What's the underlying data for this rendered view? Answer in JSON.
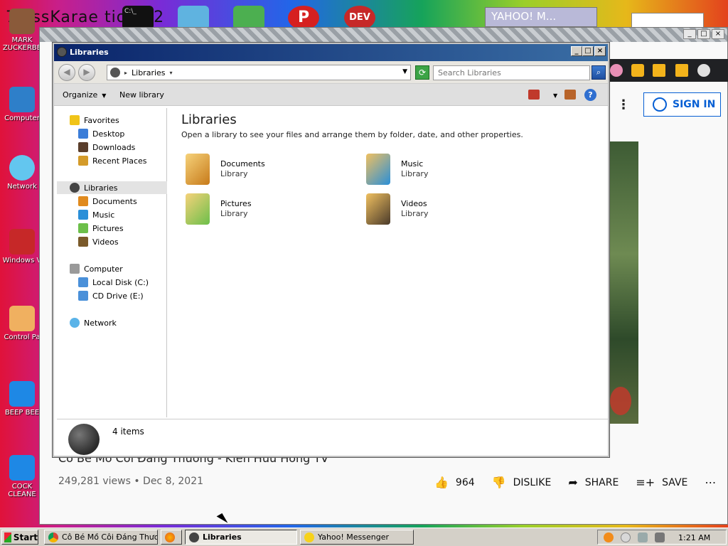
{
  "desktop": {
    "top_text": "7 ossKarae tio 012",
    "icons": [
      {
        "label": "MARK ZUCKERBE"
      },
      {
        "label": "Computer"
      },
      {
        "label": "Network"
      },
      {
        "label": "Windows V"
      },
      {
        "label": "Control Pa"
      },
      {
        "label": "BEEP BEE"
      },
      {
        "label": "COCK CLEANE"
      }
    ],
    "top_icons": [
      {
        "name": "terminal-icon",
        "label": "C:\\_"
      },
      {
        "name": "folder-icon",
        "label": ""
      },
      {
        "name": "game-icon",
        "label": ""
      },
      {
        "name": "p-icon",
        "label": "P"
      },
      {
        "name": "dev-icon",
        "label": "DEV"
      }
    ],
    "yahoo_title": "YAHOO! M..."
  },
  "browser": {
    "signin": "SIGN IN",
    "video_title": "Cô Bé Mồ Côi Đáng Thương - Kiến Hữu Hồng TV",
    "views": "249,281 views • Dec 8, 2021",
    "likes": "964",
    "dislike": "DISLIKE",
    "share": "SHARE",
    "save": "SAVE"
  },
  "explorer": {
    "title": "Libraries",
    "address": "Libraries",
    "search_placeholder": "Search Libraries",
    "organize": "Organize",
    "new_library": "New library",
    "nav": {
      "favorites": "Favorites",
      "desktop": "Desktop",
      "downloads": "Downloads",
      "recent": "Recent Places",
      "libraries": "Libraries",
      "documents": "Documents",
      "music": "Music",
      "pictures": "Pictures",
      "videos": "Videos",
      "computer": "Computer",
      "local_disk": "Local Disk (C:)",
      "cd_drive": "CD Drive (E:)",
      "network": "Network"
    },
    "heading": "Libraries",
    "subheading": "Open a library to see your files and arrange them by folder, date, and other properties.",
    "libraries": [
      {
        "name": "Documents",
        "kind": "Library"
      },
      {
        "name": "Music",
        "kind": "Library"
      },
      {
        "name": "Pictures",
        "kind": "Library"
      },
      {
        "name": "Videos",
        "kind": "Library"
      }
    ],
    "item_count": "4 items"
  },
  "taskbar": {
    "start": "Start",
    "tasks": [
      {
        "label": "Cô Bé Mồ Côi Đáng Thươ..."
      },
      {
        "label": ""
      },
      {
        "label": "Libraries"
      },
      {
        "label": "Yahoo! Messenger"
      }
    ],
    "clock": "1:21 AM"
  },
  "colors": {
    "accent": "#065fd4",
    "title_bar": "#0a246a"
  }
}
